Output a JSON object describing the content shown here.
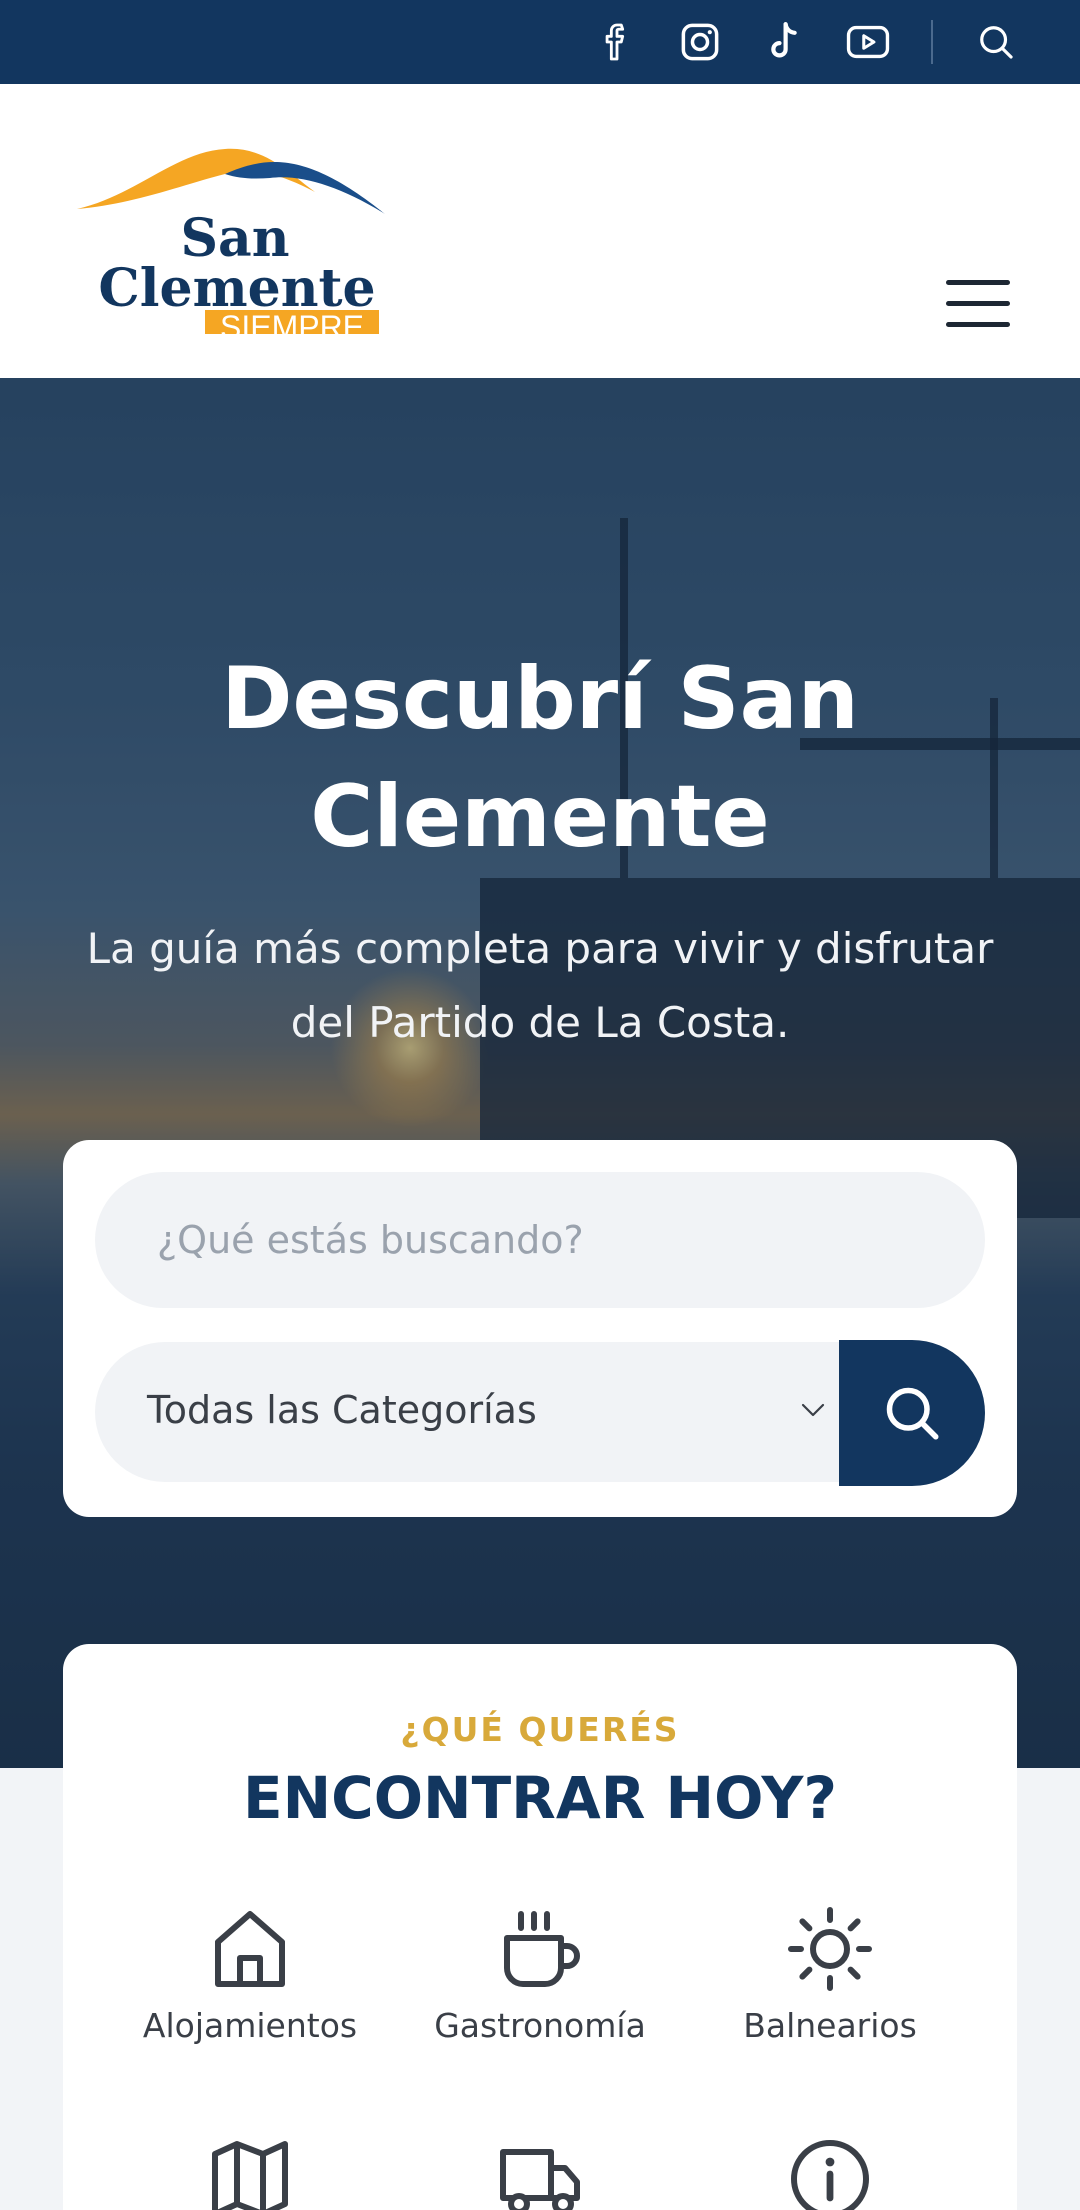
{
  "topbar": {
    "icons": [
      "facebook-icon",
      "instagram-icon",
      "tiktok-icon",
      "youtube-icon",
      "search-icon"
    ]
  },
  "header": {
    "logo": {
      "line1": "San",
      "line2": "Clemente",
      "tag": "SIEMPRE",
      "colors": {
        "blue": "#12365f",
        "orange": "#f5a623"
      }
    },
    "menu_icon": "hamburger-menu-icon"
  },
  "hero": {
    "title": "Descubrí San Clemente",
    "title_line1": "Descubrí San",
    "title_line2": "Clemente",
    "subtitle_line1": "La guía más completa para vivir y disfrutar",
    "subtitle_line2": "del Partido de La Costa."
  },
  "search": {
    "placeholder": "¿Qué estás buscando?",
    "category_selected": "Todas las Categorías",
    "button_icon": "search-icon"
  },
  "categories": {
    "kicker": "¿QUÉ QUERÉS",
    "title": "ENCONTRAR HOY?",
    "items": [
      {
        "label": "Alojamientos",
        "icon": "home-icon"
      },
      {
        "label": "Gastronomía",
        "icon": "coffee-cup-icon"
      },
      {
        "label": "Balnearios",
        "icon": "sun-icon"
      },
      {
        "label": "",
        "icon": "map-icon"
      },
      {
        "label": "",
        "icon": "truck-icon"
      },
      {
        "label": "",
        "icon": "info-icon"
      }
    ]
  },
  "colors": {
    "navy": "#12365f",
    "gold": "#d8a93a",
    "background": "#f2f4f7"
  }
}
